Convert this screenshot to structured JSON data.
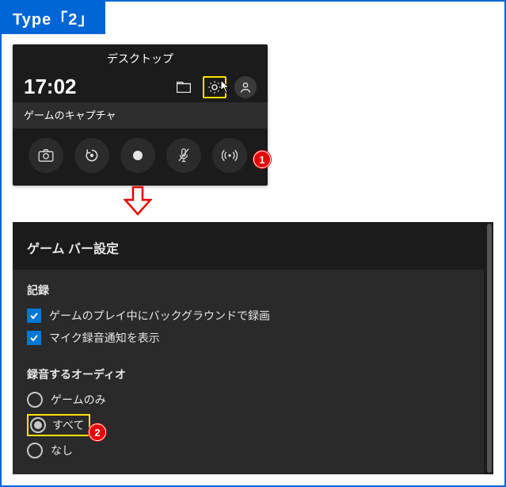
{
  "header": {
    "type_label": "Type「2」"
  },
  "panel1": {
    "title": "デスクトップ",
    "time": "17:02",
    "subtitle": "ゲームのキャプチャ",
    "icons": {
      "folder": "folder-icon",
      "gear": "gear-icon",
      "user": "user-icon"
    },
    "actions": {
      "screenshot": "camera-icon",
      "last30": "record-last-icon",
      "record": "record-icon",
      "mic": "mic-off-icon",
      "broadcast": "broadcast-icon"
    }
  },
  "callouts": {
    "c1": "1",
    "c2": "2"
  },
  "panel2": {
    "title": "ゲーム バー設定",
    "section_record": "記録",
    "chk_bg_record": "ゲームのプレイ中にバックグラウンドで録画",
    "chk_mic_notice": "マイク録音通知を表示",
    "section_audio": "録音するオーディオ",
    "radio_game": "ゲームのみ",
    "radio_all": "すべて",
    "radio_none": "なし"
  }
}
